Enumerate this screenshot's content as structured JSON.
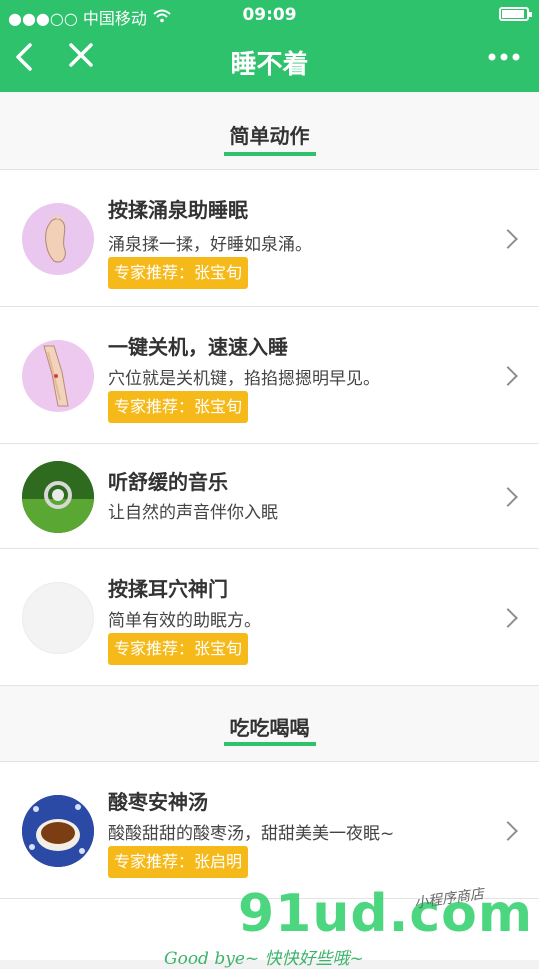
{
  "status": {
    "carrier": "●●●○○ 中国移动",
    "time": "09:09"
  },
  "nav": {
    "title": "睡不着",
    "back_icon": "chevron-left-icon",
    "close_icon": "close-icon",
    "more_icon": "more-icon"
  },
  "sections": [
    {
      "title": "简单动作",
      "items": [
        {
          "title": "按揉涌泉助睡眠",
          "desc": "涌泉揉一揉，好睡如泉涌。",
          "tag": "专家推荐：张宝旬"
        },
        {
          "title": "一键关机，速速入睡",
          "desc": "穴位就是关机键，掐掐摁摁明早见。",
          "tag": "专家推荐：张宝旬"
        },
        {
          "title": "听舒缓的音乐",
          "desc": "让自然的声音伴你入眠"
        },
        {
          "title": "按揉耳穴神门",
          "desc": "简单有效的助眠方。",
          "tag": "专家推荐：张宝旬"
        }
      ]
    },
    {
      "title": "吃吃喝喝",
      "items": [
        {
          "title": "酸枣安神汤",
          "desc": "酸酸甜甜的酸枣汤，甜甜美美一夜眠~",
          "tag": "专家推荐：张启明"
        }
      ]
    }
  ],
  "footer": {
    "text": "Good bye~ 快快好些哦~",
    "watermark": "91ud.com",
    "watermark_sub": "小程序商店"
  },
  "colors": {
    "brand_green": "#2dc26b",
    "tag_yellow": "#f5b91a"
  }
}
